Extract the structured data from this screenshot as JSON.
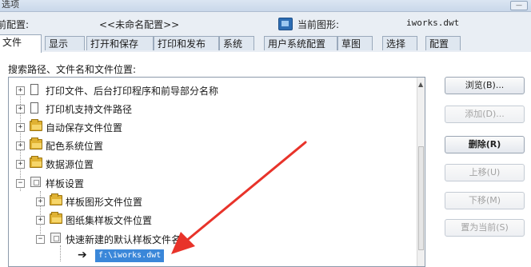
{
  "window": {
    "title": "选项"
  },
  "profile": {
    "label": "前配置:",
    "value": "<<未命名配置>>",
    "current_drawing_label": "当前图形:",
    "current_drawing_value": "iworks.dwt"
  },
  "tabs": [
    {
      "label": "文件",
      "active": true
    },
    {
      "label": "显示",
      "active": false
    },
    {
      "label": "打开和保存",
      "active": false
    },
    {
      "label": "打印和发布",
      "active": false
    },
    {
      "label": "系统",
      "active": false
    },
    {
      "label": "用户系统配置",
      "active": false
    },
    {
      "label": "草图",
      "active": false
    },
    {
      "label": "选择",
      "active": false
    },
    {
      "label": "配置",
      "active": false
    }
  ],
  "search_label": "搜索路径、文件名和文件位置:",
  "tree": {
    "items": [
      {
        "label": "打印文件、后台打印程序和前导部分名称",
        "icon": "document-icon",
        "expander": "+"
      },
      {
        "label": "打印机支持文件路径",
        "icon": "document-icon",
        "expander": "+"
      },
      {
        "label": "自动保存文件位置",
        "icon": "folder-icon",
        "expander": "+"
      },
      {
        "label": "配色系统位置",
        "icon": "folder-icon",
        "expander": "+"
      },
      {
        "label": "数据源位置",
        "icon": "folder-icon",
        "expander": "+"
      },
      {
        "label": "样板设置",
        "icon": "template-icon",
        "expander": "−"
      },
      {
        "label": "样板图形文件位置",
        "icon": "folder-icon",
        "expander": "+"
      },
      {
        "label": "图纸集样板文件位置",
        "icon": "folder-icon",
        "expander": "+"
      },
      {
        "label": "快速新建的默认样板文件名",
        "icon": "template-icon",
        "expander": "−"
      }
    ],
    "selected_value": "f:\\iworks.dwt"
  },
  "buttons": {
    "browse": "浏览(B)...",
    "add": "添加(D)...",
    "remove": "删除(R)",
    "move_up": "上移(U)",
    "move_down": "下移(M)",
    "set_current": "置为当前(S)"
  },
  "colors": {
    "selection": "#3a87d9",
    "annotation_arrow": "#e8332a",
    "folder": "#e0b233"
  }
}
